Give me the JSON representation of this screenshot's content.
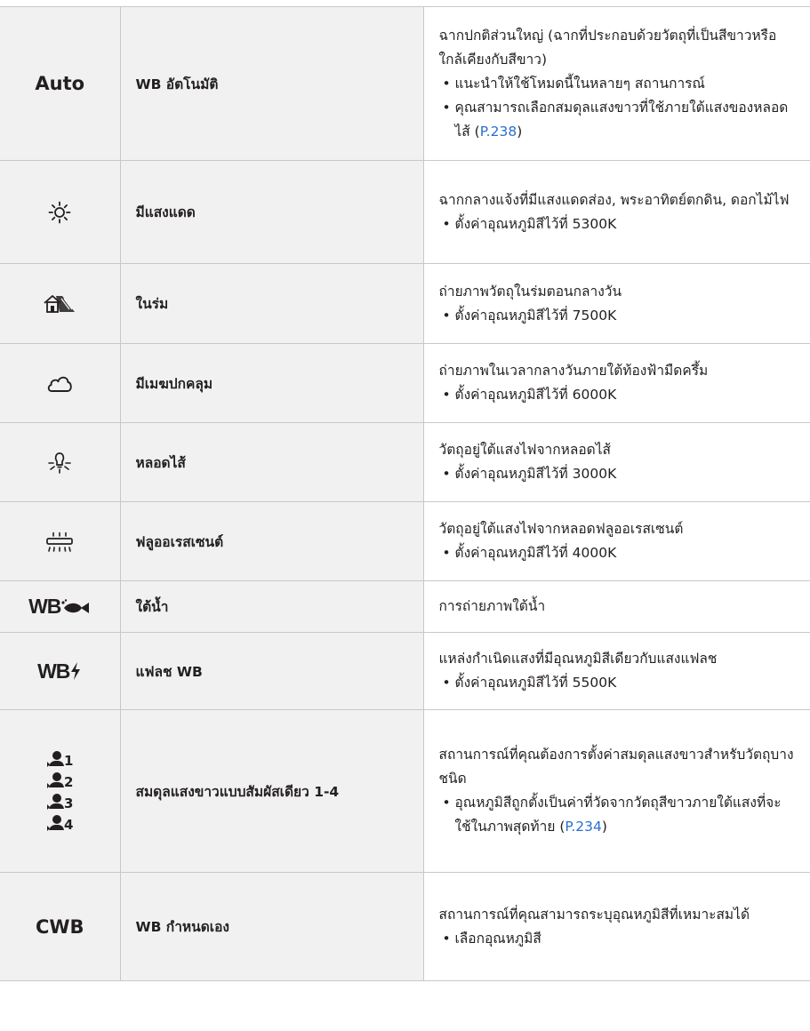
{
  "rows": [
    {
      "icon": {
        "kind": "text",
        "text": "Auto"
      },
      "name": "WB อัตโนมัติ",
      "desc": "ฉากปกติส่วนใหญ่ (ฉากที่ประกอบด้วยวัตถุที่เป็นสีขาวหรือใกล้เคียงกับสีขาว)",
      "bullets": [
        {
          "text": "แนะนำให้ใช้โหมดนี้ในหลายๆ สถานการณ์"
        },
        {
          "text": "คุณสามารถเลือกสมดุลแสงขาวที่ใช้ภายใต้แสงของหลอดไส้ (",
          "link": "P.238",
          "after": ")"
        }
      ]
    },
    {
      "icon": {
        "kind": "svg",
        "name": "sunny-icon"
      },
      "name": "มีแสงแดด",
      "desc": "ฉากกลางแจ้งที่มีแสงแดดส่อง, พระอาทิตย์ตกดิน, ดอกไม้ไฟ",
      "bullets": [
        {
          "text": "ตั้งค่าอุณหภูมิสีไว้ที่ 5300K"
        }
      ]
    },
    {
      "icon": {
        "kind": "svg",
        "name": "shade-icon"
      },
      "name": "ในร่ม",
      "desc": "ถ่ายภาพวัตถุในร่มตอนกลางวัน",
      "bullets": [
        {
          "text": "ตั้งค่าอุณหภูมิสีไว้ที่ 7500K"
        }
      ]
    },
    {
      "icon": {
        "kind": "svg",
        "name": "cloudy-icon"
      },
      "name": "มีเมฆปกคลุม",
      "desc": "ถ่ายภาพในเวลากลางวันภายใต้ท้องฟ้ามืดครึ้ม",
      "bullets": [
        {
          "text": "ตั้งค่าอุณหภูมิสีไว้ที่ 6000K"
        }
      ]
    },
    {
      "icon": {
        "kind": "svg",
        "name": "incandescent-icon"
      },
      "name": "หลอดไส้",
      "desc": "วัตถุอยู่ใต้แสงไฟจากหลอดไส้",
      "bullets": [
        {
          "text": "ตั้งค่าอุณหภูมิสีไว้ที่ 3000K"
        }
      ]
    },
    {
      "icon": {
        "kind": "svg",
        "name": "fluorescent-icon"
      },
      "name": "ฟลูออเรสเซนต์",
      "desc": "วัตถุอยู่ใต้แสงไฟจากหลอดฟลูออเรสเซนต์",
      "bullets": [
        {
          "text": "ตั้งค่าอุณหภูมิสีไว้ที่ 4000K"
        }
      ]
    },
    {
      "icon": {
        "kind": "svg",
        "name": "underwater-wb-icon",
        "text": "WB"
      },
      "name": "ใต้น้ำ",
      "desc": "การถ่ายภาพใต้น้ำ",
      "bullets": []
    },
    {
      "icon": {
        "kind": "svg",
        "name": "flash-wb-icon",
        "text": "WB"
      },
      "name": "แฟลช WB",
      "desc": "แหล่งกำเนิดแสงที่มีอุณหภูมิสีเดียวกับแสงแฟลช",
      "bullets": [
        {
          "text": "ตั้งค่าอุณหภูมิสีไว้ที่ 5500K"
        }
      ]
    },
    {
      "icon": {
        "kind": "onetouch",
        "name": "one-touch-wb-icon",
        "numbers": [
          "1",
          "2",
          "3",
          "4"
        ]
      },
      "name": "สมดุลแสงขาวแบบสัมผัสเดียว 1-4",
      "desc": "สถานการณ์ที่คุณต้องการตั้งค่าสมดุลแสงขาวสำหรับวัตถุบางชนิด",
      "bullets": [
        {
          "text": "อุณหภูมิสีถูกตั้งเป็นค่าที่วัดจากวัตถุสีขาวภายใต้แสงที่จะใช้ในภาพสุดท้าย (",
          "link": "P.234",
          "after": ")"
        }
      ]
    },
    {
      "icon": {
        "kind": "text",
        "text": "CWB"
      },
      "name": "WB กำหนดเอง",
      "desc": "สถานการณ์ที่คุณสามารถระบุอุณหภูมิสีที่เหมาะสมได้",
      "bullets": [
        {
          "text": "เลือกอุณหภูมิสี"
        }
      ]
    }
  ]
}
